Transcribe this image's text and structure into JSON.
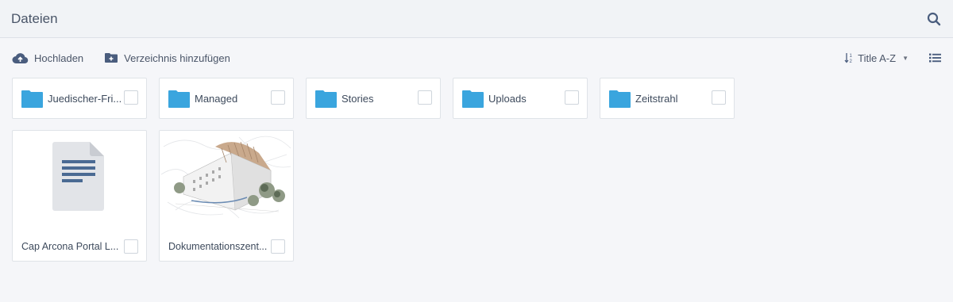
{
  "header": {
    "title": "Dateien",
    "search_icon": "search-icon"
  },
  "toolbar": {
    "upload_label": "Hochladen",
    "add_dir_label": "Verzeichnis hinzufügen",
    "sort_label": "Title A-Z",
    "sort_caret": "▼"
  },
  "folders": [
    {
      "name": "Juedischer-Fri..."
    },
    {
      "name": "Managed"
    },
    {
      "name": "Stories"
    },
    {
      "name": "Uploads"
    },
    {
      "name": "Zeitstrahl"
    }
  ],
  "files": [
    {
      "name": "Cap Arcona Portal L...",
      "type": "document"
    },
    {
      "name": "Dokumentationszent...",
      "type": "image"
    }
  ],
  "colors": {
    "folder": "#3aa5de",
    "accent": "#4a5d7e",
    "doc": "#e2e4e8",
    "doc_lines": "#4a6a93"
  }
}
